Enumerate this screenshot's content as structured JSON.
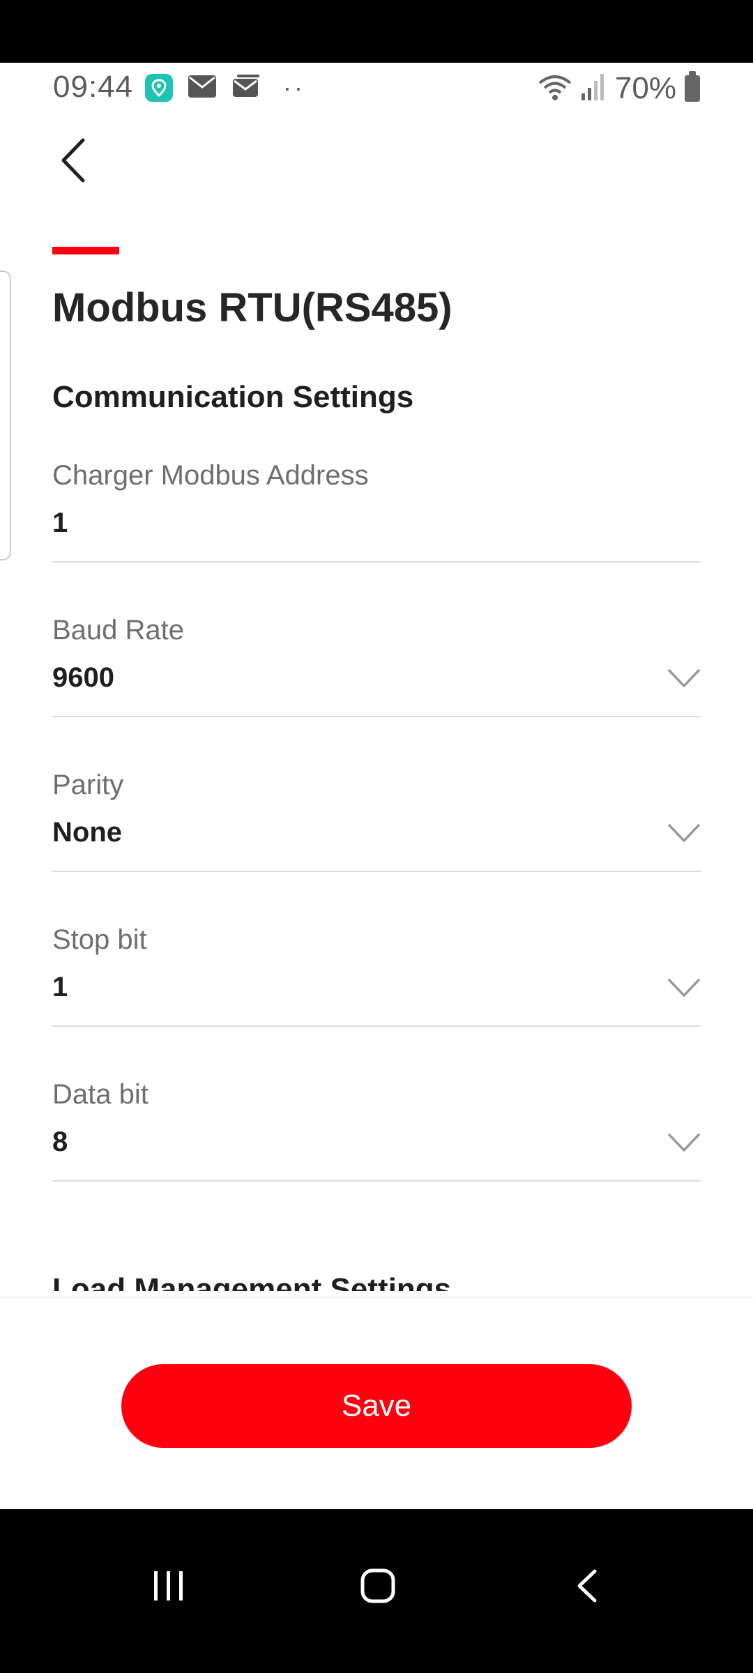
{
  "status_bar": {
    "time": "09:44",
    "battery": "70%"
  },
  "page": {
    "title": "Modbus RTU(RS485)",
    "section_title": "Communication Settings",
    "next_section_title": "Load Management Settings"
  },
  "fields": [
    {
      "label": "Charger Modbus Address",
      "value": "1"
    },
    {
      "label": "Baud Rate",
      "value": "9600"
    },
    {
      "label": "Parity",
      "value": "None"
    },
    {
      "label": "Stop bit",
      "value": "1"
    },
    {
      "label": "Data bit",
      "value": "8"
    }
  ],
  "actions": {
    "save_label": "Save"
  },
  "colors": {
    "accent": "#ff000f",
    "status_teal": "#1fc3b5"
  },
  "icons": {
    "back": "chevron-left-icon",
    "dropdown": "chevron-down-icon",
    "nav_recents": "recents-icon",
    "nav_home": "home-icon",
    "nav_back": "back-icon"
  }
}
